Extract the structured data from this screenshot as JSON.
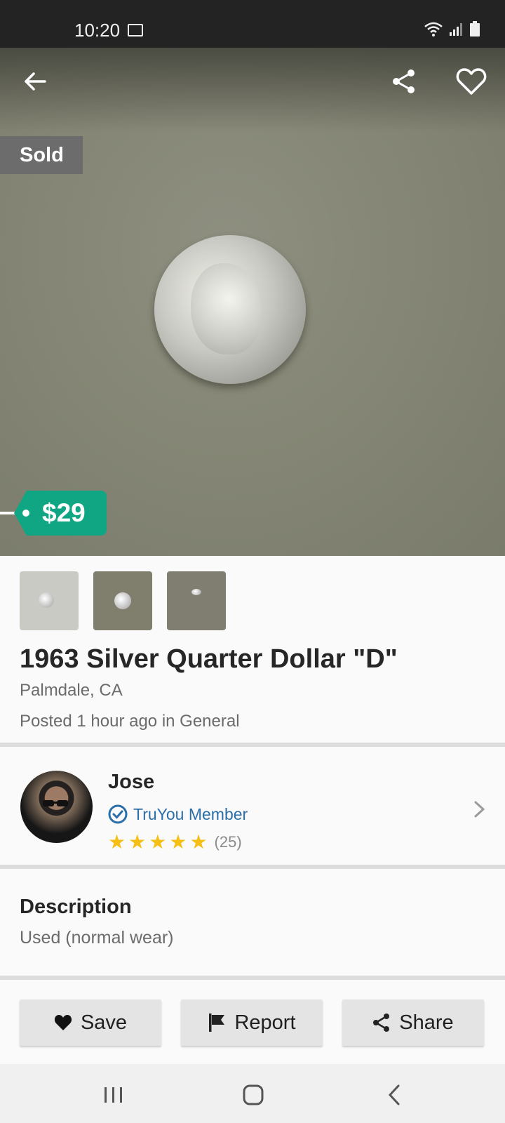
{
  "status_bar": {
    "time": "10:20"
  },
  "listing": {
    "sold_label": "Sold",
    "price": "$29",
    "title": "1963 Silver Quarter Dollar \"D\"",
    "location": "Palmdale, CA",
    "posted": "Posted 1 hour ago in General",
    "thumbnails": [
      "photo-1",
      "photo-2",
      "photo-3"
    ]
  },
  "seller": {
    "name": "Jose",
    "badge": "TruYou Member",
    "rating_stars": 5,
    "rating_count": "(25)"
  },
  "description": {
    "heading": "Description",
    "condition": "Used (normal wear)"
  },
  "actions": {
    "save": "Save",
    "report": "Report",
    "share": "Share"
  },
  "icons": {
    "back": "arrow-left-icon",
    "share": "share-icon",
    "favorite": "heart-outline-icon",
    "verified": "check-circle-icon",
    "chevron": "chevron-right-icon"
  },
  "colors": {
    "price_tag": "#11a683",
    "truyou": "#2c6fa8",
    "star": "#f6bf15"
  }
}
